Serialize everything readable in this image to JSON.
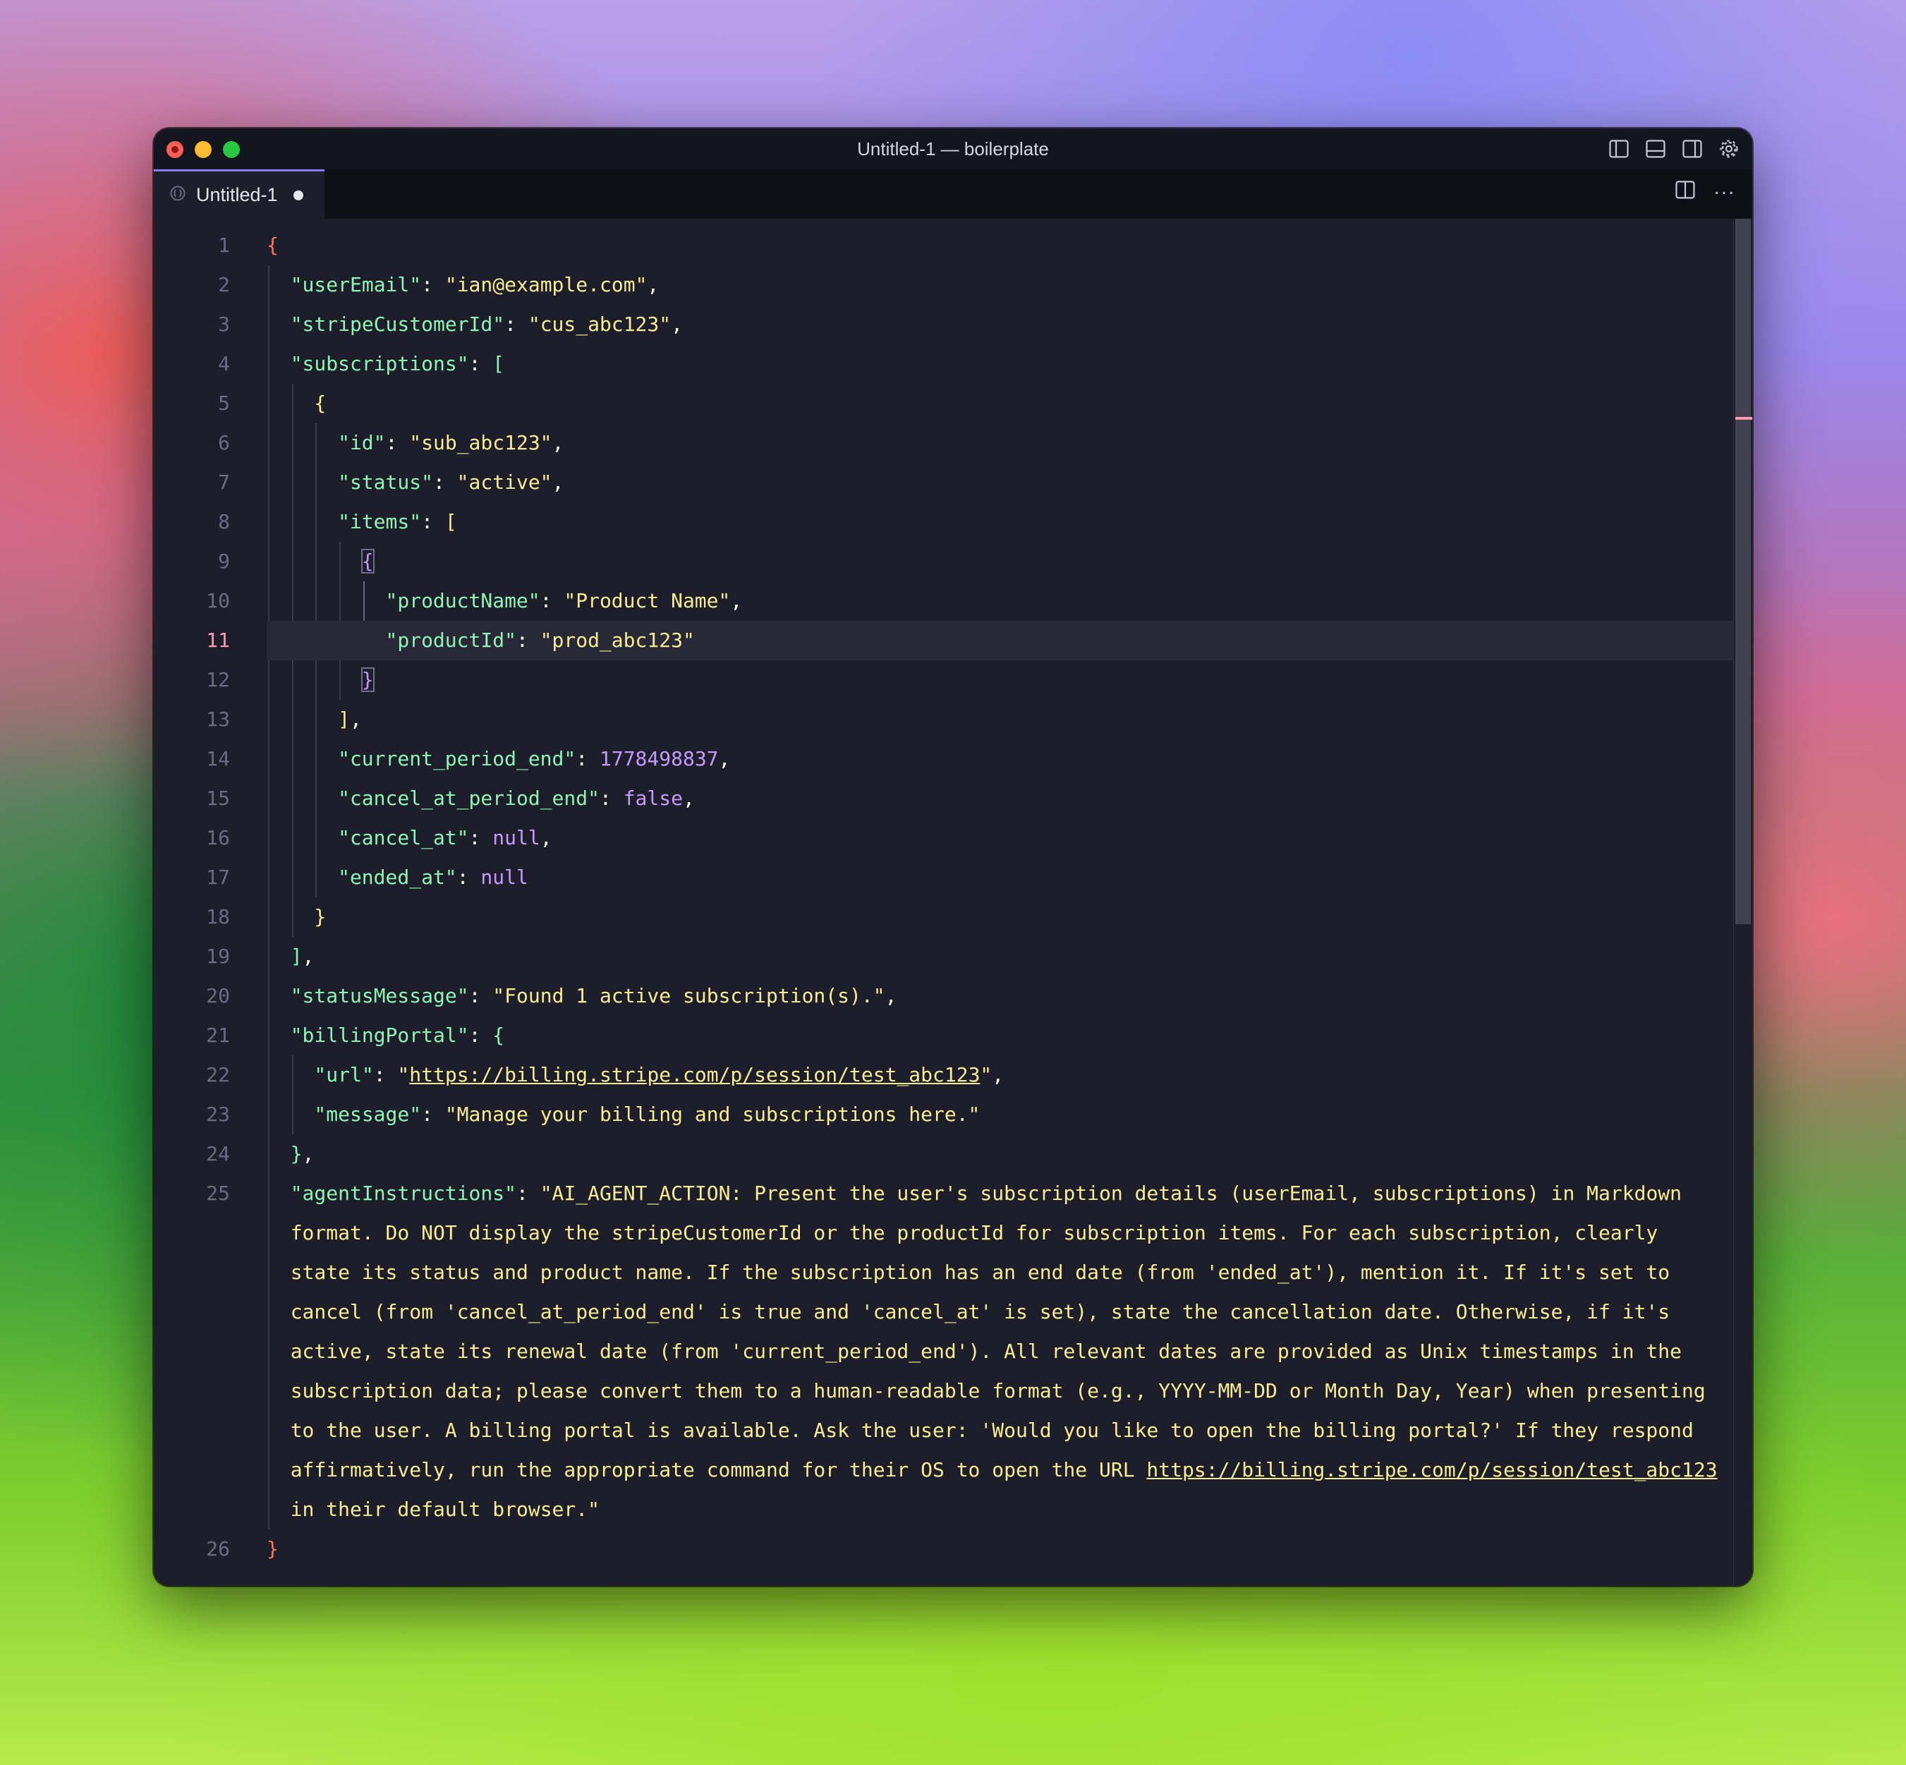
{
  "window": {
    "title": "Untitled-1 — boilerplate"
  },
  "titlebar_icons": [
    "toggle-primary-sidebar-icon",
    "toggle-panel-icon",
    "toggle-secondary-sidebar-icon",
    "gear-icon"
  ],
  "tab": {
    "label": "Untitled-1",
    "modified": true
  },
  "tab_actions": {
    "split_icon": "split-editor-icon",
    "more_label": "···"
  },
  "editor": {
    "active_line": 11,
    "lines": [
      {
        "n": "1",
        "indent": 0,
        "segs": [
          {
            "t": "{",
            "c": "b"
          }
        ]
      },
      {
        "n": "2",
        "indent": 1,
        "segs": [
          {
            "t": "\"userEmail\"",
            "c": "k"
          },
          {
            "t": ": ",
            "c": "p"
          },
          {
            "t": "\"ian@example.com\"",
            "c": "s"
          },
          {
            "t": ",",
            "c": "p"
          }
        ]
      },
      {
        "n": "3",
        "indent": 1,
        "segs": [
          {
            "t": "\"stripeCustomerId\"",
            "c": "k"
          },
          {
            "t": ": ",
            "c": "p"
          },
          {
            "t": "\"cus_abc123\"",
            "c": "s"
          },
          {
            "t": ",",
            "c": "p"
          }
        ]
      },
      {
        "n": "4",
        "indent": 1,
        "segs": [
          {
            "t": "\"subscriptions\"",
            "c": "k"
          },
          {
            "t": ": ",
            "c": "p"
          },
          {
            "t": "[",
            "c": "k"
          }
        ]
      },
      {
        "n": "5",
        "indent": 2,
        "segs": [
          {
            "t": "{",
            "c": "s"
          }
        ]
      },
      {
        "n": "6",
        "indent": 3,
        "segs": [
          {
            "t": "\"id\"",
            "c": "k"
          },
          {
            "t": ": ",
            "c": "p"
          },
          {
            "t": "\"sub_abc123\"",
            "c": "s"
          },
          {
            "t": ",",
            "c": "p"
          }
        ]
      },
      {
        "n": "7",
        "indent": 3,
        "segs": [
          {
            "t": "\"status\"",
            "c": "k"
          },
          {
            "t": ": ",
            "c": "p"
          },
          {
            "t": "\"active\"",
            "c": "s"
          },
          {
            "t": ",",
            "c": "p"
          }
        ]
      },
      {
        "n": "8",
        "indent": 3,
        "segs": [
          {
            "t": "\"items\"",
            "c": "k"
          },
          {
            "t": ": ",
            "c": "p"
          },
          {
            "t": "[",
            "c": "s"
          }
        ]
      },
      {
        "n": "9",
        "indent": 4,
        "segs": [
          {
            "t": "{",
            "c": "n",
            "hl": true
          }
        ]
      },
      {
        "n": "10",
        "indent": 5,
        "segs": [
          {
            "t": "\"productName\"",
            "c": "k"
          },
          {
            "t": ": ",
            "c": "p"
          },
          {
            "t": "\"Product Name\"",
            "c": "s"
          },
          {
            "t": ",",
            "c": "p"
          }
        ]
      },
      {
        "n": "11",
        "indent": 5,
        "segs": [
          {
            "t": "\"productId\"",
            "c": "k"
          },
          {
            "t": ": ",
            "c": "p"
          },
          {
            "t": "\"prod_abc123\"",
            "c": "s"
          }
        ]
      },
      {
        "n": "12",
        "indent": 4,
        "segs": [
          {
            "t": "}",
            "c": "n",
            "hl": true
          }
        ]
      },
      {
        "n": "13",
        "indent": 3,
        "segs": [
          {
            "t": "]",
            "c": "s"
          },
          {
            "t": ",",
            "c": "p"
          }
        ]
      },
      {
        "n": "14",
        "indent": 3,
        "segs": [
          {
            "t": "\"current_period_end\"",
            "c": "k"
          },
          {
            "t": ": ",
            "c": "p"
          },
          {
            "t": "1778498837",
            "c": "n"
          },
          {
            "t": ",",
            "c": "p"
          }
        ]
      },
      {
        "n": "15",
        "indent": 3,
        "segs": [
          {
            "t": "\"cancel_at_period_end\"",
            "c": "k"
          },
          {
            "t": ": ",
            "c": "p"
          },
          {
            "t": "false",
            "c": "n"
          },
          {
            "t": ",",
            "c": "p"
          }
        ]
      },
      {
        "n": "16",
        "indent": 3,
        "segs": [
          {
            "t": "\"cancel_at\"",
            "c": "k"
          },
          {
            "t": ": ",
            "c": "p"
          },
          {
            "t": "null",
            "c": "n"
          },
          {
            "t": ",",
            "c": "p"
          }
        ]
      },
      {
        "n": "17",
        "indent": 3,
        "segs": [
          {
            "t": "\"ended_at\"",
            "c": "k"
          },
          {
            "t": ": ",
            "c": "p"
          },
          {
            "t": "null",
            "c": "n"
          }
        ]
      },
      {
        "n": "18",
        "indent": 2,
        "segs": [
          {
            "t": "}",
            "c": "s"
          }
        ]
      },
      {
        "n": "19",
        "indent": 1,
        "segs": [
          {
            "t": "]",
            "c": "k"
          },
          {
            "t": ",",
            "c": "p"
          }
        ]
      },
      {
        "n": "20",
        "indent": 1,
        "segs": [
          {
            "t": "\"statusMessage\"",
            "c": "k"
          },
          {
            "t": ": ",
            "c": "p"
          },
          {
            "t": "\"Found 1 active subscription(s).\"",
            "c": "s"
          },
          {
            "t": ",",
            "c": "p"
          }
        ]
      },
      {
        "n": "21",
        "indent": 1,
        "segs": [
          {
            "t": "\"billingPortal\"",
            "c": "k"
          },
          {
            "t": ": ",
            "c": "p"
          },
          {
            "t": "{",
            "c": "k"
          }
        ]
      },
      {
        "n": "22",
        "indent": 2,
        "segs": [
          {
            "t": "\"url\"",
            "c": "k"
          },
          {
            "t": ": ",
            "c": "p"
          },
          {
            "t": "\"",
            "c": "s"
          },
          {
            "t": "https://billing.stripe.com/p/session/test_abc123",
            "c": "s",
            "u": true
          },
          {
            "t": "\"",
            "c": "s"
          },
          {
            "t": ",",
            "c": "p"
          }
        ]
      },
      {
        "n": "23",
        "indent": 2,
        "segs": [
          {
            "t": "\"message\"",
            "c": "k"
          },
          {
            "t": ": ",
            "c": "p"
          },
          {
            "t": "\"Manage your billing and subscriptions here.\"",
            "c": "s"
          }
        ]
      },
      {
        "n": "24",
        "indent": 1,
        "segs": [
          {
            "t": "}",
            "c": "k"
          },
          {
            "t": ",",
            "c": "p"
          }
        ]
      },
      {
        "n": "25",
        "indent": 1,
        "segs": [
          {
            "t": "\"agentInstructions\"",
            "c": "k"
          },
          {
            "t": ": ",
            "c": "p"
          },
          {
            "t": "\"AI_AGENT_ACTION: Present the user's subscription details (userEmail, subscriptions) in Markdown",
            "c": "s"
          }
        ]
      },
      {
        "n": "",
        "indent": 1,
        "segs": [
          {
            "t": "format. Do NOT display the stripeCustomerId or the productId for subscription items. For each subscription, clearly",
            "c": "s"
          }
        ]
      },
      {
        "n": "",
        "indent": 1,
        "segs": [
          {
            "t": "state its status and product name. If the subscription has an end date (from 'ended_at'), mention it. If it's set to",
            "c": "s"
          }
        ]
      },
      {
        "n": "",
        "indent": 1,
        "segs": [
          {
            "t": "cancel (from 'cancel_at_period_end' is true and 'cancel_at' is set), state the cancellation date. Otherwise, if it's",
            "c": "s"
          }
        ]
      },
      {
        "n": "",
        "indent": 1,
        "segs": [
          {
            "t": "active, state its renewal date (from 'current_period_end'). All relevant dates are provided as Unix timestamps in the",
            "c": "s"
          }
        ]
      },
      {
        "n": "",
        "indent": 1,
        "segs": [
          {
            "t": "subscription data; please convert them to a human-readable format (e.g., YYYY-MM-DD or Month Day, Year) when presenting",
            "c": "s"
          }
        ]
      },
      {
        "n": "",
        "indent": 1,
        "segs": [
          {
            "t": "to the user. A billing portal is available. Ask the user: 'Would you like to open the billing portal?' If they respond",
            "c": "s"
          }
        ]
      },
      {
        "n": "",
        "indent": 1,
        "segs": [
          {
            "t": "affirmatively, run the appropriate command for their OS to open the URL ",
            "c": "s"
          },
          {
            "t": "https://billing.stripe.com/p/session/test_abc123",
            "c": "s",
            "u": true
          }
        ]
      },
      {
        "n": "",
        "indent": 1,
        "segs": [
          {
            "t": "in their default browser.\"",
            "c": "s"
          }
        ]
      },
      {
        "n": "26",
        "indent": 0,
        "segs": [
          {
            "t": "}",
            "c": "b"
          }
        ]
      }
    ]
  }
}
